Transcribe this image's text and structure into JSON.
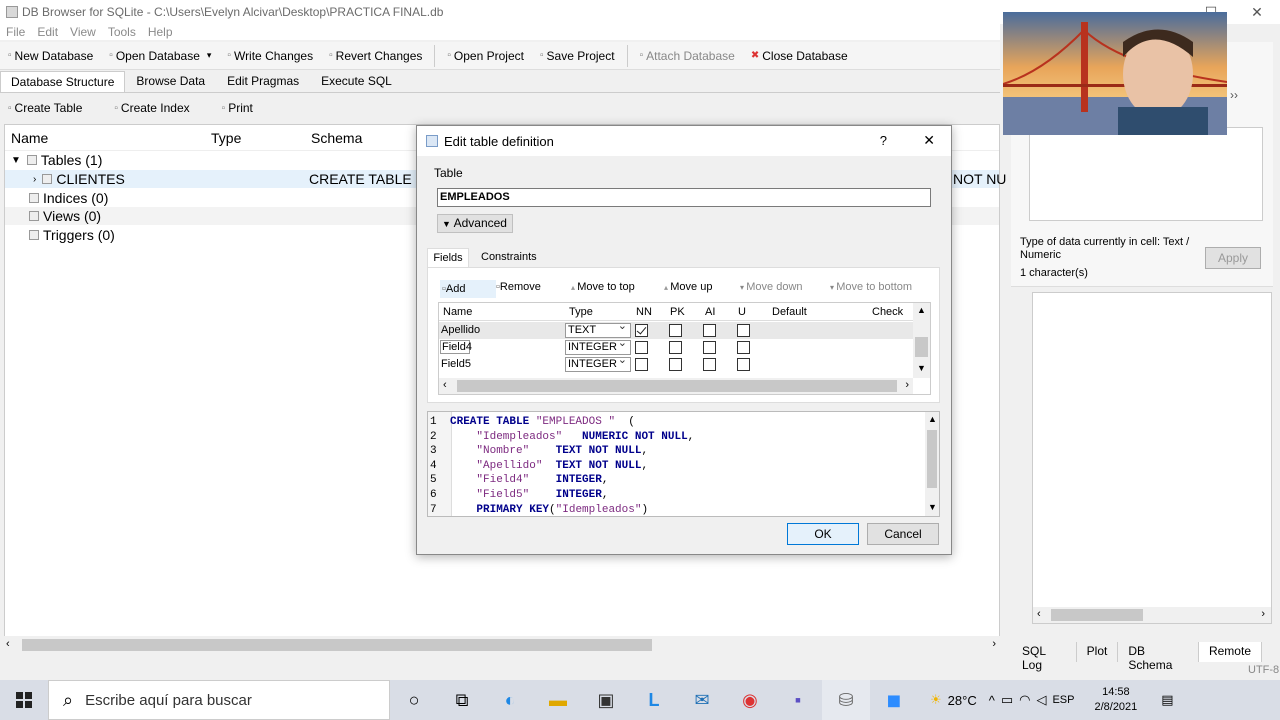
{
  "window": {
    "title": "DB Browser for SQLite - C:\\Users\\Evelyn Alcivar\\Desktop\\PRACTICA FINAL.db",
    "menu": [
      "File",
      "Edit",
      "View",
      "Tools",
      "Help"
    ]
  },
  "toolbar": {
    "new_db": "New Database",
    "open_db": "Open Database",
    "write": "Write Changes",
    "revert": "Revert Changes",
    "open_project": "Open Project",
    "save_project": "Save Project",
    "attach": "Attach Database",
    "close": "Close Database"
  },
  "main_tabs": [
    "Database Structure",
    "Browse Data",
    "Edit Pragmas",
    "Execute SQL"
  ],
  "subtoolbar": {
    "create_table": "Create Table",
    "create_index": "Create Index",
    "print": "Print"
  },
  "tree": {
    "headers": [
      "Name",
      "Type",
      "Schema"
    ],
    "tables": "Tables (1)",
    "clientes": "CLIENTES",
    "clientes_schema": "CREATE TABLE \"Cl",
    "clientes_schema_tail": "NOT NU",
    "indices": "Indices (0)",
    "views": "Views (0)",
    "triggers": "Triggers (0)"
  },
  "dialog": {
    "title": "Edit table definition",
    "help": "?",
    "close": "✕",
    "table_label": "Table",
    "table_name": "EMPLEADOS",
    "advanced": "Advanced",
    "tabs": [
      "Fields",
      "Constraints"
    ],
    "field_buttons": {
      "add": "Add",
      "remove": "Remove",
      "move_top": "Move to top",
      "move_up": "Move up",
      "move_down": "Move down",
      "move_bottom": "Move to bottom"
    },
    "columns": [
      "Name",
      "Type",
      "NN",
      "PK",
      "AI",
      "U",
      "Default",
      "Check"
    ],
    "fields": [
      {
        "name": "Apellido",
        "type": "TEXT",
        "nn": true,
        "pk": false,
        "ai": false,
        "u": false
      },
      {
        "name": "Field4",
        "type": "INTEGER",
        "nn": false,
        "pk": false,
        "ai": false,
        "u": false
      },
      {
        "name": "Field5",
        "type": "INTEGER",
        "nn": false,
        "pk": false,
        "ai": false,
        "u": false
      }
    ],
    "sql": [
      {
        "n": "1",
        "parts": [
          [
            "kw",
            "CREATE TABLE "
          ],
          [
            "str",
            "\"EMPLEADOS \""
          ],
          [
            "",
            "  ("
          ]
        ]
      },
      {
        "n": "2",
        "parts": [
          [
            "",
            "    "
          ],
          [
            "str",
            "\"Idempleados\""
          ],
          [
            "",
            "   "
          ],
          [
            "kw",
            "NUMERIC NOT NULL"
          ],
          [
            "",
            ","
          ]
        ]
      },
      {
        "n": "3",
        "parts": [
          [
            "",
            "    "
          ],
          [
            "str",
            "\"Nombre\""
          ],
          [
            "",
            "    "
          ],
          [
            "kw",
            "TEXT NOT NULL"
          ],
          [
            "",
            ","
          ]
        ]
      },
      {
        "n": "4",
        "parts": [
          [
            "",
            "    "
          ],
          [
            "str",
            "\"Apellido\""
          ],
          [
            "",
            "  "
          ],
          [
            "kw",
            "TEXT NOT NULL"
          ],
          [
            "",
            ","
          ]
        ]
      },
      {
        "n": "5",
        "parts": [
          [
            "",
            "    "
          ],
          [
            "str",
            "\"Field4\""
          ],
          [
            "",
            "    "
          ],
          [
            "kw",
            "INTEGER"
          ],
          [
            "",
            ","
          ]
        ]
      },
      {
        "n": "6",
        "parts": [
          [
            "",
            "    "
          ],
          [
            "str",
            "\"Field5\""
          ],
          [
            "",
            "    "
          ],
          [
            "kw",
            "INTEGER"
          ],
          [
            "",
            ","
          ]
        ]
      },
      {
        "n": "7",
        "parts": [
          [
            "",
            "    "
          ],
          [
            "kw",
            "PRIMARY KEY"
          ],
          [
            "",
            "("
          ],
          [
            "str",
            "\"Idempleados\""
          ],
          [
            "",
            ")"
          ]
        ]
      }
    ],
    "ok": "OK",
    "cancel": "Cancel"
  },
  "right_panel": {
    "type_info": "Type of data currently in cell: Text / Numeric",
    "char_count": "1 character(s)",
    "apply": "Apply",
    "bottom_tabs": [
      "SQL Log",
      "Plot",
      "DB Schema",
      "Remote"
    ],
    "encoding": "UTF-8"
  },
  "taskbar": {
    "search_placeholder": "Escribe aquí para buscar",
    "temperature": "28°C",
    "language": "ESP",
    "time": "14:58",
    "date": "2/8/2021"
  }
}
